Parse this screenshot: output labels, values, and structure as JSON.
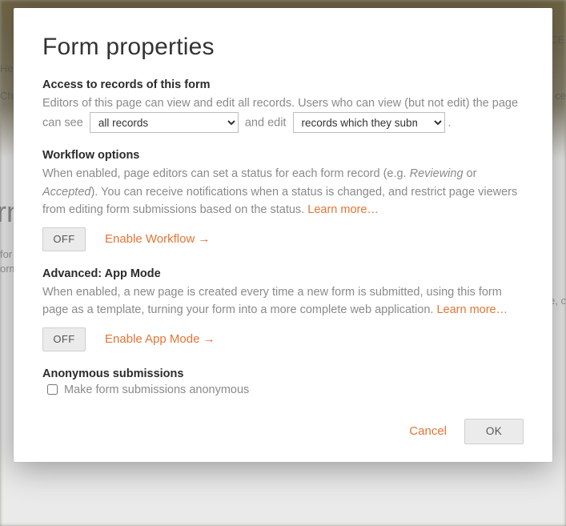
{
  "modal": {
    "title": "Form properties",
    "access": {
      "heading": "Access to records of this form",
      "desc_prefix": "Editors of this page can view and edit all records. Users who can view (but not edit) the page can see",
      "view_select": "all records",
      "mid_text": "and edit",
      "edit_select": "records which they submit",
      "suffix": "."
    },
    "workflow": {
      "heading": "Workflow options",
      "desc_a": "When enabled, page editors can set a status for each form record (e.g. ",
      "desc_em1": "Reviewing",
      "desc_b": " or ",
      "desc_em2": "Accepted",
      "desc_c": "). You can receive notifications when a status is changed, and restrict page viewers from editing form submissions based on the status.  ",
      "learn_more": "Learn more…",
      "toggle": "OFF",
      "enable": "Enable Workflow →"
    },
    "appmode": {
      "heading": "Advanced: App Mode",
      "desc": "When enabled, a new page is created every time a new form is submitted, using this form page as a template, turning your form into a more complete web application. ",
      "learn_more": "Learn more…",
      "toggle": "OFF",
      "enable": "Enable App Mode →"
    },
    "anon": {
      "heading": "Anonymous submissions",
      "checkbox_label": "Make form submissions anonymous",
      "checked": false
    },
    "footer": {
      "cancel": "Cancel",
      "ok": "OK"
    }
  }
}
